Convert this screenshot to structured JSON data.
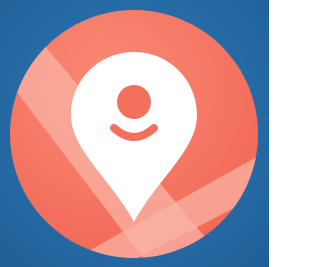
{
  "icon": {
    "name": "location-person-pin-icon",
    "description_visible_text": "",
    "colors": {
      "background_blue": "#2B73AF",
      "background_blue_dark": "#1F5E96",
      "circle_coral": "#F4705C",
      "circle_coral_light": "#F88B75",
      "stripe_light": "#F9B3A4",
      "pin_white": "#FFFFFF",
      "face_coral": "#F2705C"
    }
  }
}
